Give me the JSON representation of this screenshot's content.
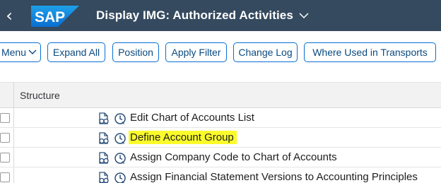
{
  "header": {
    "back_glyph": "‹",
    "logo_text": "SAP",
    "title": "Display IMG: Authorized Activities",
    "colors": {
      "shell_bg": "#354a5f",
      "logo_blue": "#0a6ed1"
    }
  },
  "toolbar": {
    "buttons": [
      {
        "label": "Menu"
      },
      {
        "label": "Expand All"
      },
      {
        "label": "Position"
      },
      {
        "label": "Apply Filter"
      },
      {
        "label": "Change Log"
      },
      {
        "label": "Where Used in Transports"
      }
    ],
    "colors": {
      "button_border": "#0a6ed1",
      "button_text": "#0a4a80"
    }
  },
  "table": {
    "header": "Structure",
    "rows": [
      {
        "text": "Edit Chart of Accounts List",
        "highlighted": false
      },
      {
        "text": "Define Account Group",
        "highlighted": true
      },
      {
        "text": "Assign Company Code to Chart of Accounts",
        "highlighted": false
      },
      {
        "text": "Assign Financial Statement Versions to Accounting Principles",
        "highlighted": false
      }
    ],
    "row_icons": [
      "documentation-icon",
      "change-log-clock-icon"
    ],
    "colors": {
      "highlight": "#fbfb2c"
    }
  }
}
